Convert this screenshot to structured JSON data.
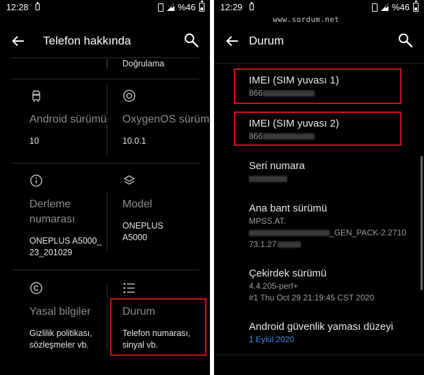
{
  "watermark": "www.sordum.net",
  "left": {
    "status": {
      "time": "12:28",
      "battery": "%46"
    },
    "title": "Telefon hakkında",
    "top_snip": "Doğrulama",
    "cells": [
      {
        "title": "Android sürümü",
        "value": "10",
        "icon": "android-icon"
      },
      {
        "title": "OxygenOS sürüm",
        "value": "10.0.1",
        "icon": "oxygenos-icon"
      },
      {
        "title": "Derleme numarası",
        "value": "ONEPLUS A5000_23_201029",
        "icon": "info-icon"
      },
      {
        "title": "Model",
        "value": "ONEPLUS A5000",
        "icon": "layers-icon"
      },
      {
        "title": "Yasal bilgiler",
        "value": "Gizlilik politikası, sözleşmeler vb.",
        "icon": "copyright-icon"
      },
      {
        "title": "Durum",
        "value": "Telefon numarası, sinyal vb.",
        "icon": "list-icon"
      }
    ]
  },
  "right": {
    "status": {
      "time": "12:29",
      "battery": "%46"
    },
    "title": "Durum",
    "items": [
      {
        "title": "IMEI (SIM yuvası 1)",
        "value": "866"
      },
      {
        "title": "IMEI (SIM yuvası 2)",
        "value": "866"
      },
      {
        "title": "Seri numara",
        "value": ""
      },
      {
        "title": "Ana bant sürümü",
        "value_line1": "MPSS.AT.",
        "value_line2": "_GEN_PACK-2.2710",
        "value_line3": "73.1.27"
      },
      {
        "title": "Çekirdek sürümü",
        "value_line1": "4.4.205-perf+",
        "value_line2": "#1 Thu Oct 29 21:19:45 CST 2020"
      },
      {
        "title": "Android güvenlik yaması düzeyi",
        "value": "1 Eylül 2020"
      }
    ]
  },
  "colors": {
    "highlight": "#c8141c",
    "link": "#4a90e2",
    "background": "#000000"
  }
}
